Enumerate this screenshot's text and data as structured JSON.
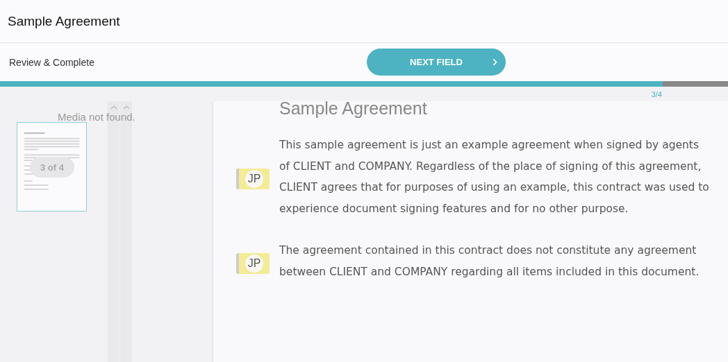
{
  "header": {
    "title": "Sample Agreement"
  },
  "toolbar": {
    "label": "Review & Complete",
    "next_button": {
      "label": "NEXT FIELD",
      "icon": "›"
    }
  },
  "progress": {
    "level": 0.91,
    "reading": "3/4"
  },
  "sidebar": {
    "message": "Media not found.",
    "page_badge": "3 of 4",
    "thumbnail": {
      "selected": true
    }
  },
  "document": {
    "title": "Sample Agreement",
    "paragraphs": [
      {
        "text": "This sample agreement is just an example agreement when signed by agents of CLIENT and COMPANY. Regardless of the place of signing of this agreement, CLIENT agrees that for purposes of using an example, this contract was used to experience document signing features and for no other purpose.",
        "initials": "JP"
      },
      {
        "text": "The agreement contained in this contract does not constitute any agreement between CLIENT and COMPANY regarding all items included in this document.",
        "initials": "JP"
      }
    ]
  }
}
